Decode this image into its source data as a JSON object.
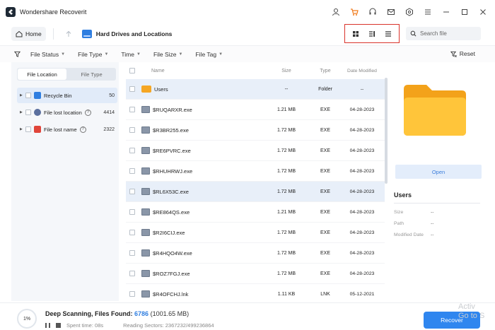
{
  "app": {
    "title": "Wondershare Recoverit"
  },
  "nav": {
    "home_label": "Home",
    "breadcrumb": "Hard Drives and Locations"
  },
  "search": {
    "placeholder": "Search file"
  },
  "filters": [
    {
      "label": "File Status"
    },
    {
      "label": "File Type"
    },
    {
      "label": "Time"
    },
    {
      "label": "File Size"
    },
    {
      "label": "File Tag"
    }
  ],
  "reset_label": "Reset",
  "sidebar": {
    "tabs": [
      {
        "label": "File Location"
      },
      {
        "label": "File Type"
      }
    ],
    "items": [
      {
        "label": "Recycle Bin",
        "count": "50",
        "color": "#2f7ee0"
      },
      {
        "label": "File lost location",
        "count": "4414",
        "color": "#5a6f9e"
      },
      {
        "label": "File lost name",
        "count": "2322",
        "color": "#e0453a"
      }
    ]
  },
  "table": {
    "headers": {
      "name": "Name",
      "size": "Size",
      "type": "Type",
      "date": "Date Modified"
    },
    "rows": [
      {
        "name": "Users",
        "size": "--",
        "type": "Folder",
        "date": "--"
      },
      {
        "name": "$RUQARXR.exe",
        "size": "1.21 MB",
        "type": "EXE",
        "date": "04-28-2023"
      },
      {
        "name": "$R3BR255.exe",
        "size": "1.72 MB",
        "type": "EXE",
        "date": "04-28-2023"
      },
      {
        "name": "$RE6PVRC.exe",
        "size": "1.72 MB",
        "type": "EXE",
        "date": "04-28-2023"
      },
      {
        "name": "$RHUHRWJ.exe",
        "size": "1.72 MB",
        "type": "EXE",
        "date": "04-28-2023"
      },
      {
        "name": "$RL6X53C.exe",
        "size": "1.72 MB",
        "type": "EXE",
        "date": "04-28-2023"
      },
      {
        "name": "$RE864QS.exe",
        "size": "1.21 MB",
        "type": "EXE",
        "date": "04-28-2023"
      },
      {
        "name": "$R2I6CIJ.exe",
        "size": "1.72 MB",
        "type": "EXE",
        "date": "04-28-2023"
      },
      {
        "name": "$R4HQO4W.exe",
        "size": "1.72 MB",
        "type": "EXE",
        "date": "04-28-2023"
      },
      {
        "name": "$ROZ7FGJ.exe",
        "size": "1.72 MB",
        "type": "EXE",
        "date": "04-28-2023"
      },
      {
        "name": "$R4OFCHJ.lnk",
        "size": "1.11 KB",
        "type": "LNK",
        "date": "05-12-2021"
      }
    ]
  },
  "preview": {
    "open_label": "Open",
    "name": "Users",
    "meta": [
      {
        "key": "Size",
        "value": "--"
      },
      {
        "key": "Path",
        "value": "--"
      },
      {
        "key": "Modified Date",
        "value": "--"
      }
    ]
  },
  "status": {
    "progress": "1%",
    "title": "Deep Scanning, Files Found:",
    "found": "6786",
    "found_size": "(1001.65 MB)",
    "spent": "Spent time: 08s",
    "sectors": "Reading Sectors: 2367232/499236864"
  },
  "recover_label": "Recover",
  "watermark": {
    "line1": "Activ",
    "line2": "Go to S"
  },
  "colors": {
    "accent": "#2f86ef",
    "highlight_border": "#d9332b",
    "folder": "#f5a623"
  }
}
